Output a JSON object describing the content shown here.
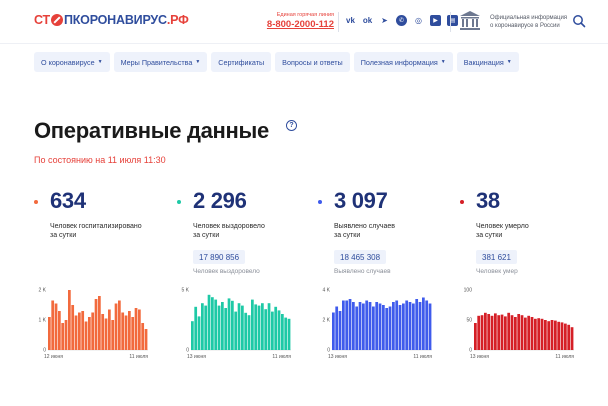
{
  "header": {
    "logo_part1": "СТ",
    "logo_part2": "ПКОРОНАВИРУС",
    "logo_part3": ".РФ",
    "hotline_label": "Единая горячая линия",
    "hotline_number": "8-800-2000-112",
    "social_icons": [
      "vk-icon",
      "ok-icon",
      "telegram-icon",
      "viber-icon",
      "whatsapp-icon",
      "youtube-icon",
      "news-icon"
    ],
    "gov_text_line1": "Официальная информация",
    "gov_text_line2": "о коронавирусе в России"
  },
  "nav": [
    {
      "label": "О коронавирусе",
      "has_dropdown": true
    },
    {
      "label": "Меры Правительства",
      "has_dropdown": true
    },
    {
      "label": "Сертификаты",
      "has_dropdown": false
    },
    {
      "label": "Вопросы и ответы",
      "has_dropdown": false
    },
    {
      "label": "Полезная информация",
      "has_dropdown": true
    },
    {
      "label": "Вакцинация",
      "has_dropdown": true
    }
  ],
  "page": {
    "title": "Оперативные данные",
    "help": "?",
    "as_of": "По состоянию на 11 июля 11:30"
  },
  "cards": [
    {
      "value": "634",
      "desc1": "Человек госпитализировано",
      "desc2": "за сутки",
      "total": "",
      "total_label": "",
      "color": "#f26a3d"
    },
    {
      "value": "2 296",
      "desc1": "Человек выздоровело",
      "desc2": "за сутки",
      "total": "17 890 856",
      "total_label": "Человек выздоровело",
      "color": "#1ec9a6"
    },
    {
      "value": "3 097",
      "desc1": "Выявлено случаев",
      "desc2": "за сутки",
      "total": "18 465 308",
      "total_label": "Выявлено случаев",
      "color": "#3f5bec"
    },
    {
      "value": "38",
      "desc1": "Человек умерло",
      "desc2": "за сутки",
      "total": "381 621",
      "total_label": "Человек умер",
      "color": "#d51f26"
    }
  ],
  "chart_data": [
    {
      "type": "bar",
      "title": "",
      "yticks": [
        "2 K",
        "1 K",
        "0"
      ],
      "ylim": [
        0,
        2000
      ],
      "x_start_label": "12 июня",
      "x_end_label": "11 июля",
      "color": "#f26a3d",
      "values": [
        1100,
        1650,
        1550,
        1300,
        900,
        1000,
        2000,
        1500,
        1150,
        1250,
        1300,
        950,
        1100,
        1250,
        1700,
        1800,
        1200,
        1050,
        1350,
        1000,
        1550,
        1650,
        1250,
        1150,
        1300,
        1100,
        1400,
        1350,
        900,
        700
      ]
    },
    {
      "type": "bar",
      "title": "",
      "yticks": [
        "5 K",
        "0"
      ],
      "ylim": [
        0,
        5000
      ],
      "x_start_label": "13 июня",
      "x_end_label": "11 июля",
      "color": "#1ec9a6",
      "values": [
        2400,
        3600,
        2800,
        3900,
        3700,
        4600,
        4400,
        4200,
        3700,
        4000,
        3500,
        4300,
        4100,
        3200,
        3900,
        3700,
        3100,
        2900,
        4200,
        3800,
        3700,
        3900,
        3400,
        3900,
        3200,
        3600,
        3300,
        3000,
        2700,
        2600
      ]
    },
    {
      "type": "bar",
      "title": "",
      "yticks": [
        "4 K",
        "2 K",
        "0"
      ],
      "ylim": [
        0,
        4000
      ],
      "x_start_label": "13 июня",
      "x_end_label": "11 июля",
      "color": "#3f5bec",
      "values": [
        2500,
        2900,
        2600,
        3300,
        3300,
        3400,
        3200,
        2900,
        3200,
        3100,
        3300,
        3200,
        2900,
        3200,
        3100,
        3000,
        2800,
        2900,
        3200,
        3300,
        3000,
        3100,
        3300,
        3200,
        3100,
        3400,
        3200,
        3500,
        3300,
        3100
      ]
    },
    {
      "type": "bar",
      "title": "",
      "yticks": [
        "100",
        "50",
        "0"
      ],
      "ylim": [
        0,
        100
      ],
      "x_start_label": "13 июня",
      "x_end_label": "11 июля",
      "color": "#d51f26",
      "values": [
        45,
        57,
        58,
        62,
        60,
        57,
        61,
        58,
        59,
        56,
        62,
        58,
        55,
        60,
        58,
        54,
        57,
        55,
        52,
        53,
        52,
        50,
        48,
        50,
        49,
        47,
        46,
        44,
        42,
        38
      ]
    }
  ]
}
